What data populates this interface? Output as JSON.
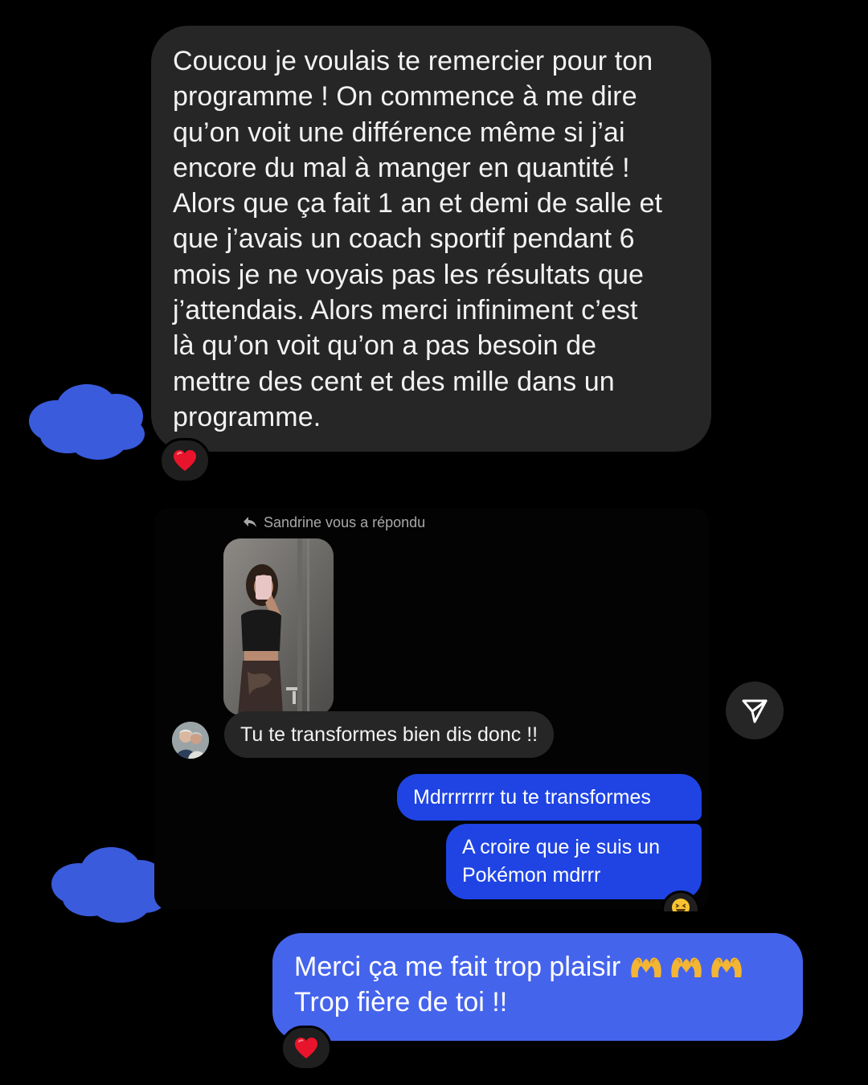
{
  "conversation": {
    "first_message": {
      "lines": [
        "Coucou je voulais te remercier pour ton",
        "programme ! On commence à me dire",
        "qu’on voit une différence même si j’ai",
        "encore du mal à manger en quantité !",
        "Alors que ça fait 1 an et demi de salle et",
        "que j’avais un coach sportif pendant 6",
        "mois je ne voyais pas les résultats que",
        "j’attendais. Alors merci infiniment c’est",
        "là qu’on voit qu’on a pas besoin de",
        "mettre des cent et des mille dans un",
        "programme."
      ],
      "reaction": "heart"
    },
    "reply_block": {
      "note": "Sandrine vous a répondu",
      "received": "Tu te transformes bien dis donc !!",
      "sent_1": "Mdrrrrrrrr tu te transformes",
      "sent_2_lines": [
        "A croire que je suis un",
        "Pokémon mdrrr"
      ],
      "sent_2_reaction": "grinning-squint-face"
    },
    "final_message": {
      "line_1": "Merci ça me fait trop plaisir",
      "line_2": "Trop fière de toi !!",
      "emoji_count": 3,
      "emoji": "heart-hands",
      "reaction": "heart"
    }
  },
  "colors": {
    "background": "#000000",
    "received_bubble": "#262626",
    "sent_bubble_dark": "#1f44e3",
    "sent_bubble_light": "#4564ec",
    "cloud": "#3a5bdc",
    "heart": "#e8142b"
  }
}
